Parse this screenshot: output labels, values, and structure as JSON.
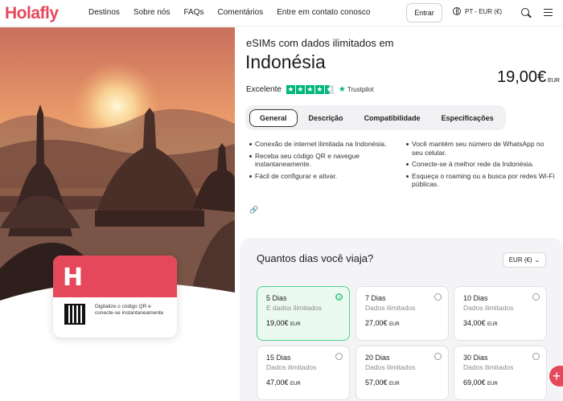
{
  "brand": {
    "logo": "Holafly",
    "accent": "#e6485b",
    "success": "#4bd08d"
  },
  "nav": {
    "links": [
      "Destinos",
      "Sobre nós",
      "FAQs",
      "Comentários",
      "Entre em contato conosco"
    ],
    "login_label": "Entrar",
    "language_label": "PT - EUR (€)"
  },
  "product": {
    "subtitle": "eSIMs com dados ilimitados em",
    "title": "Indonésia",
    "price": "19,00€",
    "price_currency": "EUR",
    "rating_label": "Excelente",
    "rating_stars": 4.5,
    "trustpilot_label": "Trustpilot"
  },
  "tabs": [
    "General",
    "Descrição",
    "Compatibilidade",
    "Especificações"
  ],
  "features_left": [
    "Conexão de internet ilimitada na Indonésia.",
    "Receba seu código QR e navegue instantaneamente.",
    "Fácil de configurar e ativar."
  ],
  "features_right": [
    "Você mantém seu número de WhatsApp no seu celular.",
    "Conecte-se à melhor rede da Indonésia.",
    "Esqueça o roaming ou a busca por redes Wi-Fi públicas."
  ],
  "card": {
    "qr_text": "Digitalize o código QR e conecte-se instantaneamente"
  },
  "plans_section": {
    "title": "Quantos dias você viaja?",
    "currency_label": "EUR (€)",
    "plans": [
      {
        "days": "5 Dias",
        "label": "E dados ilimitados",
        "price": "19,00€",
        "cur": "EUR",
        "selected": true
      },
      {
        "days": "7 Dias",
        "label": "Dados ilimitados",
        "price": "27,00€",
        "cur": "EUR",
        "selected": false
      },
      {
        "days": "10 Dias",
        "label": "Dados ilimitados",
        "price": "34,00€",
        "cur": "EUR",
        "selected": false
      },
      {
        "days": "15 Dias",
        "label": "Dados ilimitados",
        "price": "47,00€",
        "cur": "EUR",
        "selected": false
      },
      {
        "days": "20 Dias",
        "label": "Dados ilimitados",
        "price": "57,00€",
        "cur": "EUR",
        "selected": false
      },
      {
        "days": "30 Dias",
        "label": "Dados ilimitados",
        "price": "69,00€",
        "cur": "EUR",
        "selected": false
      }
    ]
  }
}
